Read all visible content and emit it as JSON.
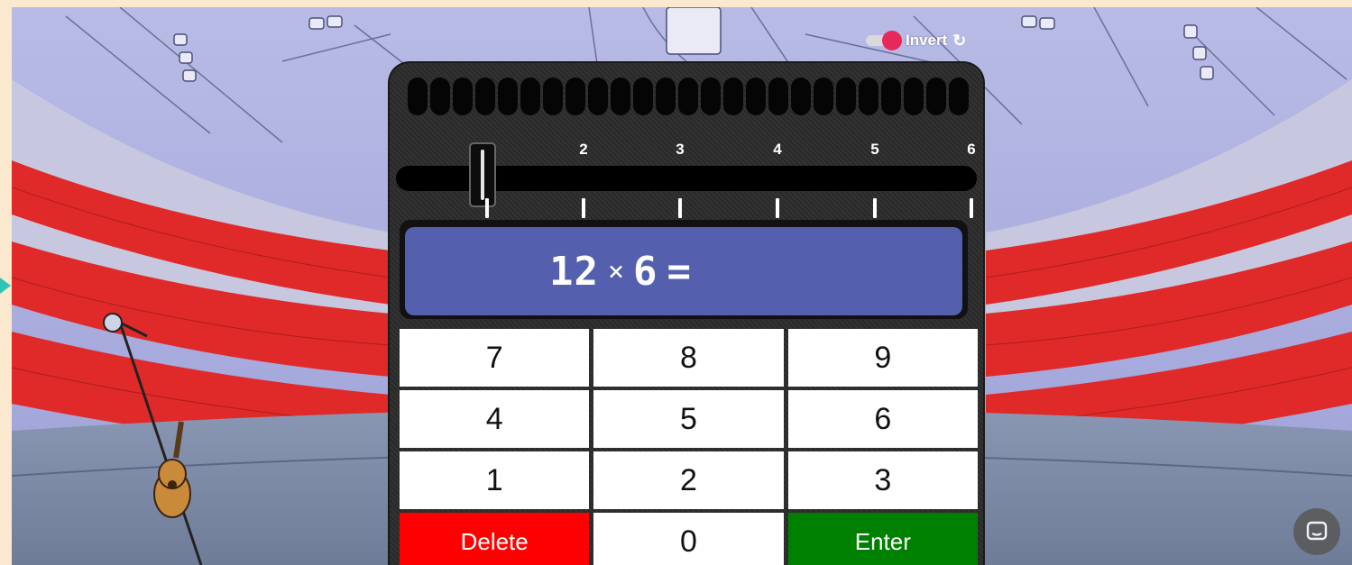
{
  "invert": {
    "label": "Invert",
    "enabled": true,
    "icon": "refresh-icon"
  },
  "slider": {
    "scale_labels": [
      "2",
      "3",
      "4",
      "5",
      "6"
    ],
    "value": 1,
    "min": 1,
    "max": 6
  },
  "display": {
    "operand_a": "12",
    "operator": "×",
    "operand_b": "6",
    "equals": "="
  },
  "keypad": {
    "keys": [
      "7",
      "8",
      "9",
      "4",
      "5",
      "6",
      "1",
      "2",
      "3",
      "Delete",
      "0",
      "Enter"
    ]
  },
  "colors": {
    "screen": "#5460ad",
    "delete": "#ff0000",
    "enter": "#008000",
    "toggle_knob": "#e8285a",
    "page_background": "#fbe9cf"
  },
  "chat": {
    "icon": "chat-icon"
  }
}
